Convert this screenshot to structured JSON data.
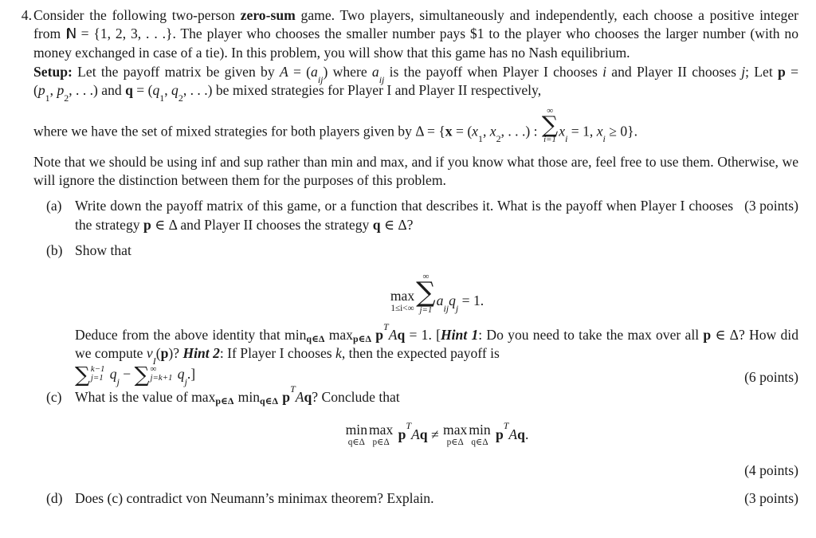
{
  "document": {
    "problem_number": "4.",
    "intro": {
      "text_before_zerosum": "Consider the following two-person ",
      "zerosum": "zero-sum",
      "text_after_zerosum": " game.  Two players, simultaneously and independently, each choose a positive integer from ",
      "nat_symbol": "N",
      "nat_equals": " = ",
      "nat_set": "{1, 2, 3, . . .}",
      "text_tail": ".  The player who chooses the smaller number pays $1 to the player who chooses the larger number (with no money exchanged in case of a tie).  In this problem, you will show that this game has no Nash equilibrium."
    },
    "setup": {
      "label": "Setup:",
      "line1_a": " Let the payoff matrix be given by ",
      "matrix_A": "A",
      "eq1": " = (",
      "a_ij": "a",
      "a_ij_sub": "ij",
      "eq1_close": ") where ",
      "a_ij_2": "a",
      "a_ij_2_sub": "ij",
      "line1_b": " is the payoff when Player I chooses ",
      "index_i": "i",
      "line1_c": " and Player II chooses ",
      "index_j": "j",
      "line1_d": "; Let ",
      "p_bold": "p",
      "p_eq": " = (",
      "p_comp": "p",
      "p_sub1": "1",
      "p_comp2": "p",
      "p_sub2": "2",
      "p_dots": ", . . .) and ",
      "q_bold": "q",
      "q_eq": " = (",
      "q_comp": "q",
      "q_sub1": "1",
      "q_comp2": "q",
      "q_sub2": "2",
      "q_dots": ", . . .) be mixed strategies for Player I and Player II respectively,",
      "line3_a": "where we have the set of mixed strategies for both players given by ",
      "delta": "Δ",
      "delta_eq": " = {",
      "x_bold": "x",
      "x_eq": " = (",
      "x1": "x",
      "x1_sub": "1",
      "x2": "x",
      "x2_sub": "2",
      "x_dots": ", . . .) : ",
      "sum_upper": "∞",
      "sum_glyph": "∑",
      "sum_lower": "i=1",
      "xi": "x",
      "xi_sub": "i",
      "sum_eq": " = 1, ",
      "xi2": "x",
      "xi2_sub": "i",
      "ge_zero": " ≥ 0}."
    },
    "note": "Note that we should be using inf and sup rather than min and max, and if you know what those are, feel free to use them.  Otherwise, we will ignore the distinction between them for the purposes of this problem.",
    "items": [
      {
        "label": "(a)",
        "text_1": "Write down the payoff matrix of this game, or a function that describes it.  What is the payoff when Player I chooses the strategy ",
        "p_bold": "p",
        "in_delta_1": " ∈ Δ",
        "text_2": " and Player II chooses the strategy ",
        "q_bold": "q",
        "in_delta_2": " ∈ Δ",
        "text_3": "?",
        "points": "(3 points)"
      },
      {
        "label": "(b)",
        "text_1": "Show that",
        "display": {
          "max_name": "max",
          "max_under": "1≤i<∞",
          "sum_upper": "∞",
          "sum_glyph": "∑",
          "sum_lower": "j=1",
          "a": "a",
          "a_sub": "ij",
          "q": "q",
          "q_sub": "j",
          "equals": " = 1."
        },
        "deduce_1": "Deduce from the above identity that ",
        "min_op": "min",
        "min_sub": "q∈Δ",
        "max_op": "max",
        "max_sub": "p∈Δ",
        "p_bold": "p",
        "transpose": "T",
        "A": "A",
        "q_bold": "q",
        "deduce_2": " = 1. [",
        "hint1": "Hint 1",
        "hint1_text": ": Do you need to take the max over all ",
        "p_bold2": "p",
        "in_delta": " ∈ Δ",
        "hint1_text2": "? How did we compute ",
        "v_I": "v",
        "v_I_sub": "I",
        "v_I_arg_open": "(",
        "p_bold3": "p",
        "v_I_arg_close": ")",
        "hint1_text3": "? ",
        "hint2": "Hint 2",
        "hint2_text": ": If Player I chooses ",
        "k": "k",
        "hint2_text2": ", then the expected payoff is ",
        "sum1_glyph": "∑",
        "sum1_upper": "k−1",
        "sum1_lower": "j=1",
        "q1": "q",
        "q1_sub": "j",
        "minus": " − ",
        "sum2_glyph": "∑",
        "sum2_upper": "∞",
        "sum2_lower": "j=k+1",
        "q2": "q",
        "q2_sub": "j",
        "closing": ".]",
        "points": "(6 points)"
      },
      {
        "label": "(c)",
        "text_1": "What is the value of ",
        "max_op": "max",
        "max_sub": "p∈Δ",
        "min_op": "min",
        "min_sub": "q∈Δ",
        "p_bold": "p",
        "transpose": "T",
        "A": "A",
        "q_bold": "q",
        "text_2": "?  Conclude that",
        "display": {
          "min_name": "min",
          "min_under": "q∈Δ",
          "max_name": "max",
          "max_under": "p∈Δ",
          "p_bold": "p",
          "transpose": "T",
          "A": "A",
          "q_bold": "q",
          "neq": " ≠ ",
          "max_name2": "max",
          "max_under2": "p∈Δ",
          "min_name2": "min",
          "min_under2": "q∈Δ",
          "p_bold2": "p",
          "transpose2": "T",
          "A2": "A",
          "q_bold2": "q",
          "period": "."
        },
        "points": "(4 points)"
      },
      {
        "label": "(d)",
        "text_1": "Does (c) contradict von Neumann’s minimax theorem?  Explain.",
        "points": "(3 points)"
      }
    ]
  }
}
